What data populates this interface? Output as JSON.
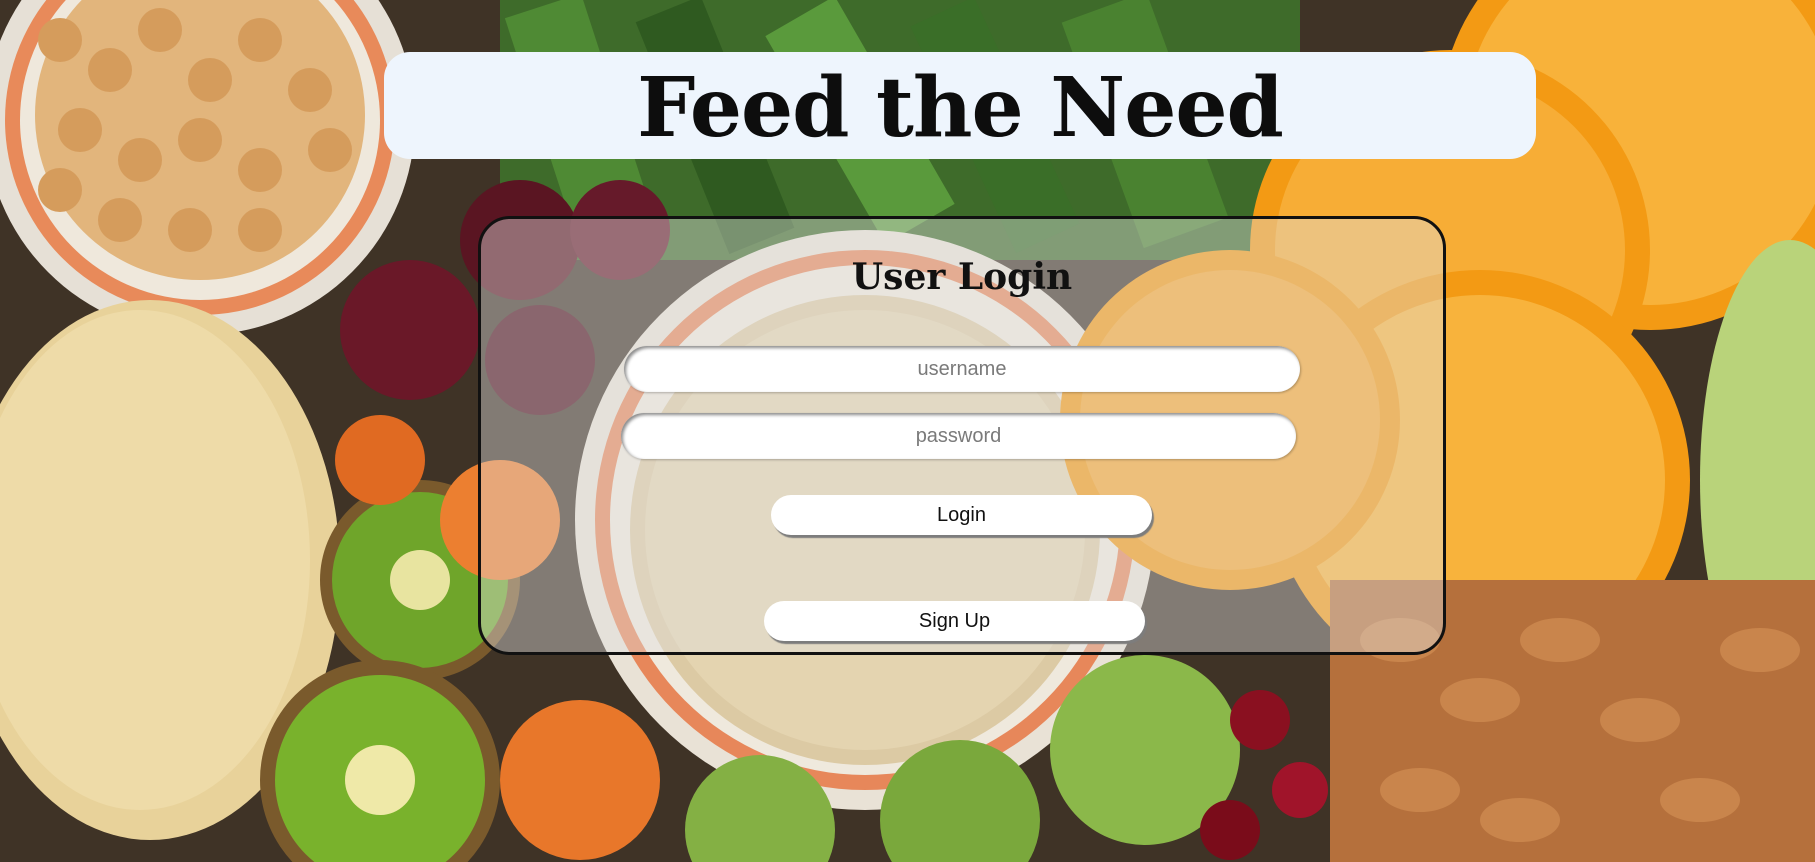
{
  "page": {
    "title": "Feed the Need"
  },
  "login": {
    "heading": "User Login",
    "username_placeholder": "username",
    "username_value": "",
    "password_placeholder": "password",
    "password_value": "",
    "login_label": "Login",
    "signup_label": "Sign Up"
  },
  "colors": {
    "title_bar_bg": "#eef5fd",
    "card_border": "#111111",
    "button_bg": "#ffffff"
  }
}
